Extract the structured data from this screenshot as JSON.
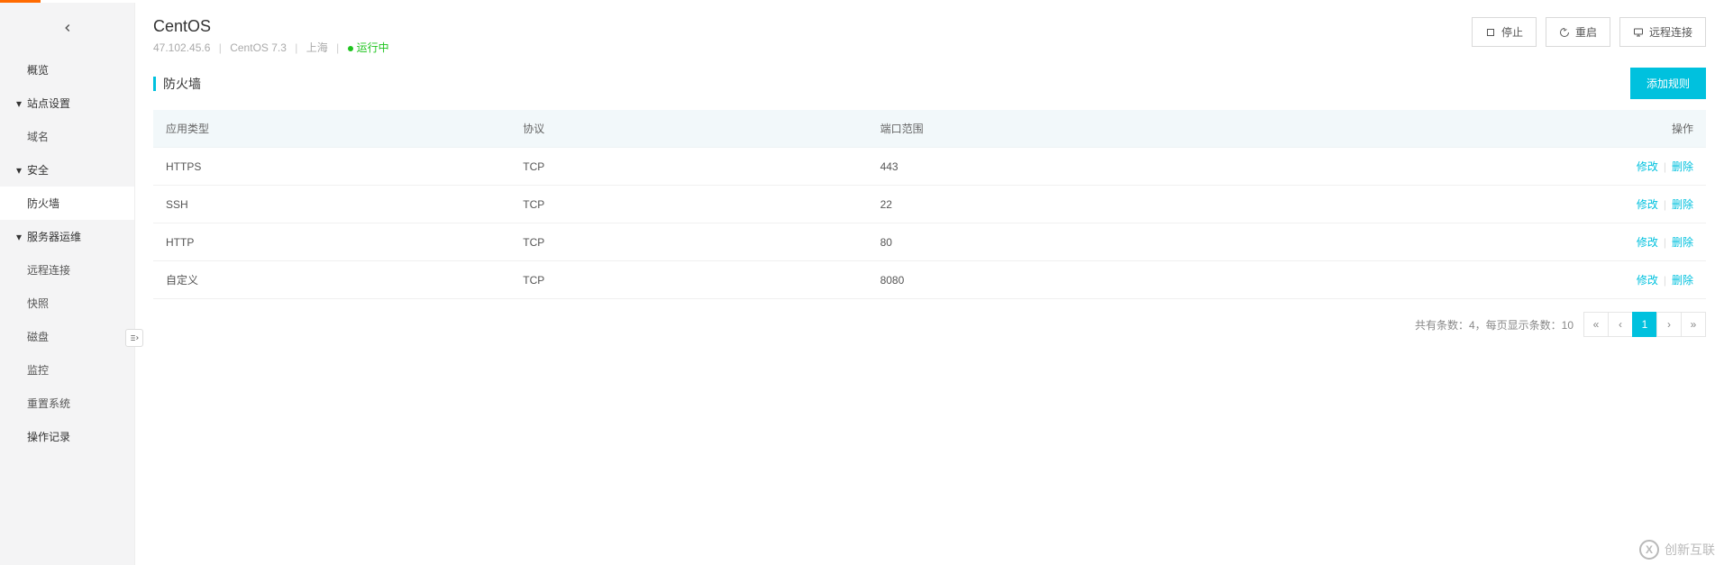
{
  "header": {
    "title": "CentOS",
    "ip": "47.102.45.6",
    "os": "CentOS 7.3",
    "region": "上海",
    "status": "运行中",
    "actions": {
      "stop": "停止",
      "restart": "重启",
      "remote": "远程连接"
    }
  },
  "sidebar": {
    "overview": "概览",
    "site": "站点设置",
    "site_children": {
      "domain": "域名"
    },
    "security": "安全",
    "security_children": {
      "firewall": "防火墙"
    },
    "ops": "服务器运维",
    "ops_children": {
      "remote": "远程连接",
      "snapshot": "快照",
      "disk": "磁盘",
      "monitor": "监控",
      "reset": "重置系统"
    },
    "log": "操作记录"
  },
  "section": {
    "title": "防火墙",
    "add_rule": "添加规则"
  },
  "table": {
    "headers": {
      "type": "应用类型",
      "protocol": "协议",
      "port": "端口范围",
      "action": "操作"
    },
    "action_edit": "修改",
    "action_delete": "删除",
    "rows": [
      {
        "type": "HTTPS",
        "protocol": "TCP",
        "port": "443"
      },
      {
        "type": "SSH",
        "protocol": "TCP",
        "port": "22"
      },
      {
        "type": "HTTP",
        "protocol": "TCP",
        "port": "80"
      },
      {
        "type": "自定义",
        "protocol": "TCP",
        "port": "8080"
      }
    ]
  },
  "pager": {
    "info": "共有条数：4，每页显示条数：10",
    "first": "«",
    "prev": "‹",
    "page1": "1",
    "next": "›",
    "last": "»"
  },
  "watermark": "创新互联"
}
